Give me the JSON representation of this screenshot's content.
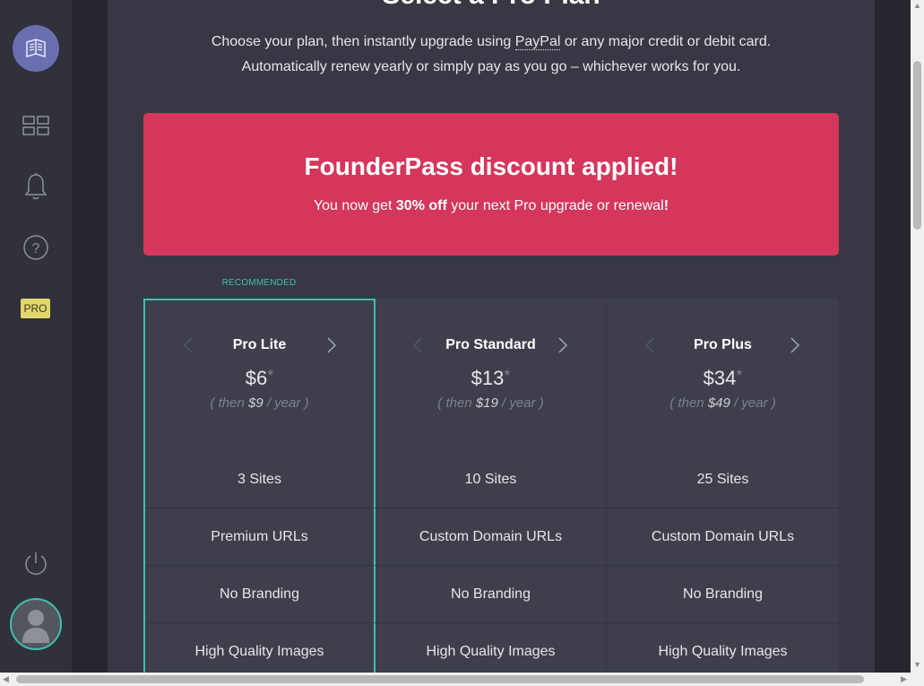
{
  "sidebar": {
    "logo_icon": "book-icon",
    "icons": [
      "grid-icon",
      "bell-icon",
      "help-icon"
    ],
    "pro_badge": "PRO",
    "power_icon": "power-icon",
    "avatar_icon": "user-avatar-icon"
  },
  "header": {
    "title": "Select a Pro Plan",
    "intro_line1_a": "Choose your plan, then instantly upgrade using ",
    "intro_paypal": "PayPal",
    "intro_line1_b": " or any major credit or debit card.",
    "intro_line2": "Automatically renew yearly or simply pay as you go – whichever works for you."
  },
  "banner": {
    "title": "FounderPass discount applied!",
    "text_a": "You now get ",
    "text_bold": "30% off",
    "text_b": " your next Pro upgrade or renewal",
    "text_end": "!",
    "color": "#d5365c"
  },
  "recommended_label": "RECOMMENDED",
  "plans": [
    {
      "name": "Pro Lite",
      "price": "$6",
      "asterisk": "*",
      "then_a": "( then ",
      "then_price": "$9",
      "then_b": " / year )",
      "features": [
        "3 Sites",
        "Premium URLs",
        "No Branding",
        "High Quality Images"
      ]
    },
    {
      "name": "Pro Standard",
      "price": "$13",
      "asterisk": "*",
      "then_a": "( then ",
      "then_price": "$19",
      "then_b": " / year )",
      "features": [
        "10 Sites",
        "Custom Domain URLs",
        "No Branding",
        "High Quality Images"
      ]
    },
    {
      "name": "Pro Plus",
      "price": "$34",
      "asterisk": "*",
      "then_a": "( then ",
      "then_price": "$49",
      "then_b": " / year )",
      "features": [
        "25 Sites",
        "Custom Domain URLs",
        "No Branding",
        "High Quality Images"
      ]
    }
  ],
  "colors": {
    "accent": "#3fbfb0",
    "pro_badge": "#e3d66b"
  }
}
